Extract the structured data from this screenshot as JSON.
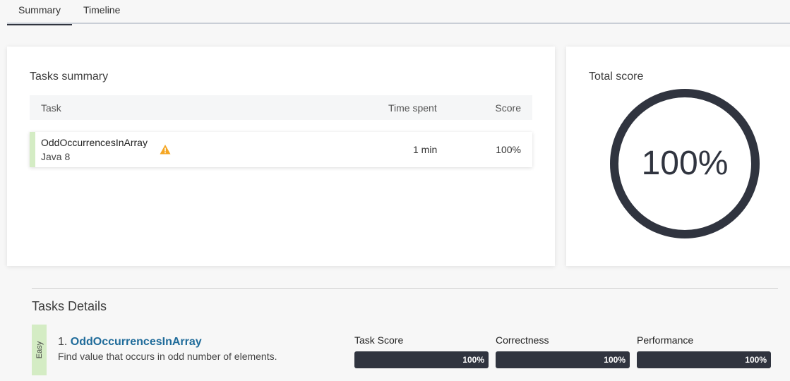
{
  "tabs": [
    "Summary",
    "Timeline"
  ],
  "tasks_summary": {
    "title": "Tasks summary",
    "columns": {
      "task": "Task",
      "time": "Time spent",
      "score": "Score"
    },
    "rows": [
      {
        "name": "OddOccurrencesInArray",
        "language": "Java 8",
        "time": "1 min",
        "score": "100%",
        "warning_icon": "warning-triangle-icon"
      }
    ]
  },
  "total_score": {
    "title": "Total score",
    "value": "100%",
    "fraction": 1.0
  },
  "tasks_details": {
    "title": "Tasks Details",
    "items": [
      {
        "difficulty": "Easy",
        "number": "1.",
        "name": "OddOccurrencesInArray",
        "description": "Find value that occurs in odd number of elements.",
        "metrics": [
          {
            "label": "Task Score",
            "value": "100%"
          },
          {
            "label": "Correctness",
            "value": "100%"
          },
          {
            "label": "Performance",
            "value": "100%"
          }
        ]
      }
    ]
  },
  "colors": {
    "dark": "#30343f",
    "easy_green": "#d4ecc4",
    "warning": "#f5a623",
    "link": "#1f6b9a"
  }
}
